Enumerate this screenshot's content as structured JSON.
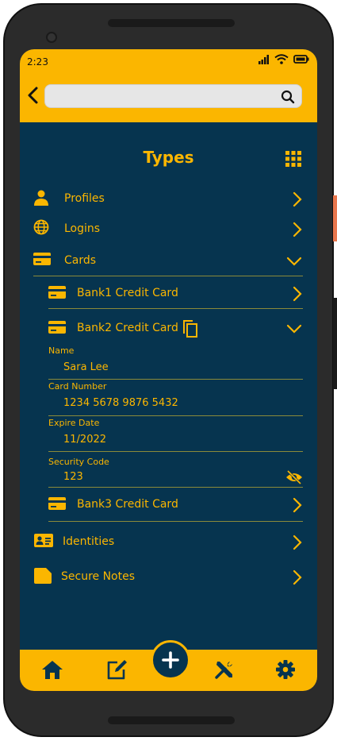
{
  "status": {
    "time": "2:23"
  },
  "search": {
    "placeholder": ""
  },
  "page": {
    "title": "Types"
  },
  "categories": {
    "profiles": "Profiles",
    "logins": "Logins",
    "cards": "Cards",
    "identities": "Identities",
    "secure_notes": "Secure Notes"
  },
  "cards": {
    "card1": "Bank1 Credit Card",
    "card2": "Bank2 Credit Card",
    "card3": "Bank3 Credit Card"
  },
  "card_details": {
    "name_label": "Name",
    "name_value": "Sara Lee",
    "number_label": "Card Number",
    "number_value": "1234 5678 9876 5432",
    "expire_label": "Expire Date",
    "expire_value": "11/2022",
    "security_label": "Security Code",
    "security_value": "123"
  },
  "bottom_nav": [
    "home-icon",
    "edit-icon",
    "add-icon",
    "tools-icon",
    "settings-icon"
  ],
  "colors": {
    "accent": "#fbb600",
    "background": "#06344f",
    "divider": "#8a8a3a"
  }
}
